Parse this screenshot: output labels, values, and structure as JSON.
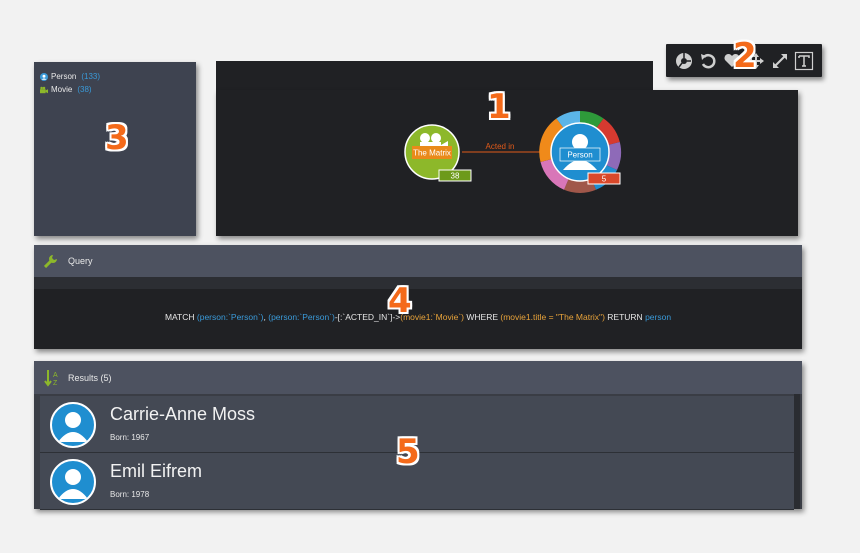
{
  "legend": {
    "items": [
      {
        "label": "Person",
        "count": "(133)",
        "color": "#3a9ad9",
        "icon": "person-icon"
      },
      {
        "label": "Movie",
        "count": "(38)",
        "color": "#8db82a",
        "icon": "movie-camera-icon"
      }
    ]
  },
  "graph": {
    "movie_node": {
      "label": "The Matrix",
      "badge": "38",
      "color": "#8db82a"
    },
    "person_node": {
      "label": "Person",
      "badge": "5",
      "color": "#1f8ed0"
    },
    "relationship": {
      "label": "Acted in",
      "color": "#e05a1a"
    }
  },
  "toolbar": {
    "tools": [
      "color-palette-icon",
      "undo-icon",
      "heart-icon",
      "move-icon",
      "expand-icon",
      "text-icon"
    ]
  },
  "query": {
    "title": "Query",
    "parts": {
      "match": "MATCH ",
      "p1": "(person:`Person`)",
      "comma": ", ",
      "p2": "(person:`Person`)",
      "rel": "-[:`ACTED_IN`]->",
      "p3": "(movie1:`Movie`)",
      "where": " WHERE ",
      "cond": "(movie1.title = \"The Matrix\")",
      "ret": " RETURN ",
      "retvar": "person"
    }
  },
  "results": {
    "title": "Results (5)",
    "rows": [
      {
        "name": "Carrie-Anne Moss",
        "born": "Born: 1967"
      },
      {
        "name": "Emil Eifrem",
        "born": "Born: 1978"
      }
    ]
  },
  "callouts": [
    "1",
    "2",
    "3",
    "4",
    "5"
  ],
  "colors": {
    "accent": "#f46a1a",
    "panel": "#202124",
    "header": "#4d5260"
  }
}
